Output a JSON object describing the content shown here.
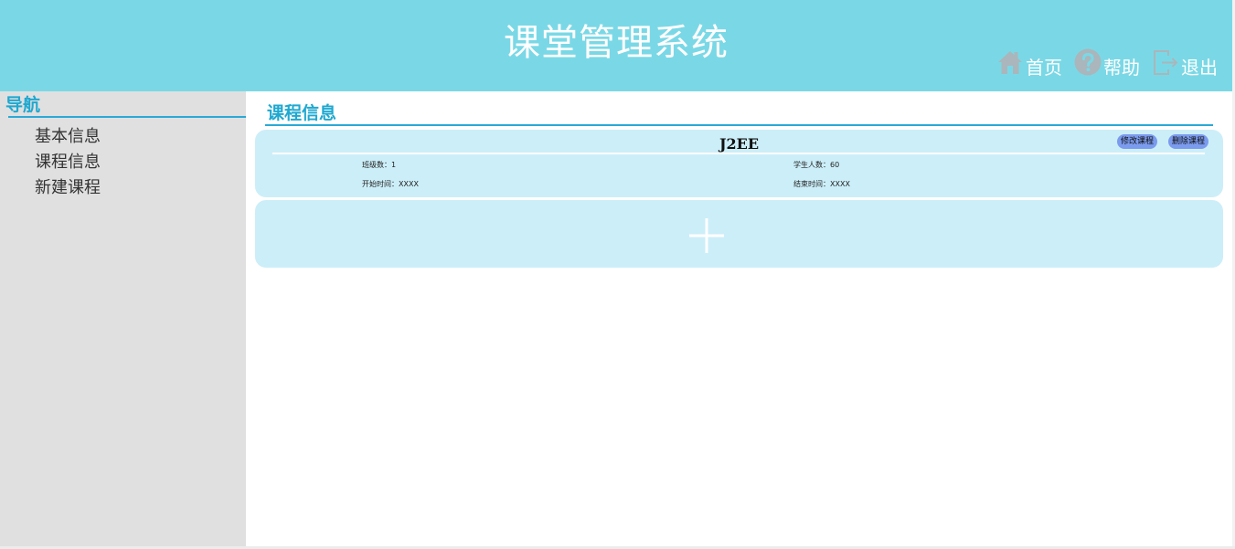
{
  "header": {
    "title": "课堂管理系统",
    "nav": [
      {
        "label": "首页",
        "icon": "home-icon"
      },
      {
        "label": "帮助",
        "icon": "help-icon"
      },
      {
        "label": "退出",
        "icon": "logout-icon"
      }
    ],
    "background_color": "#7ad8e6"
  },
  "sidebar": {
    "title": "导航",
    "items": [
      {
        "label": "基本信息"
      },
      {
        "label": "课程信息"
      },
      {
        "label": "新建课程"
      }
    ],
    "background_color": "#e0e0e0"
  },
  "main": {
    "section_title": "课程信息",
    "course": {
      "name": "J2EE",
      "edit_label": "修改课程",
      "delete_label": "删除课程",
      "class_count": "班级数：1",
      "student_count": "学生人数：60",
      "start_time": "开始时间：XXXX",
      "end_time": "结束时间：XXXX"
    },
    "add_card_icon": "plus-icon",
    "accent_color": "#2aa9d6",
    "card_color": "#cceef8",
    "button_color": "#7b9bee"
  }
}
